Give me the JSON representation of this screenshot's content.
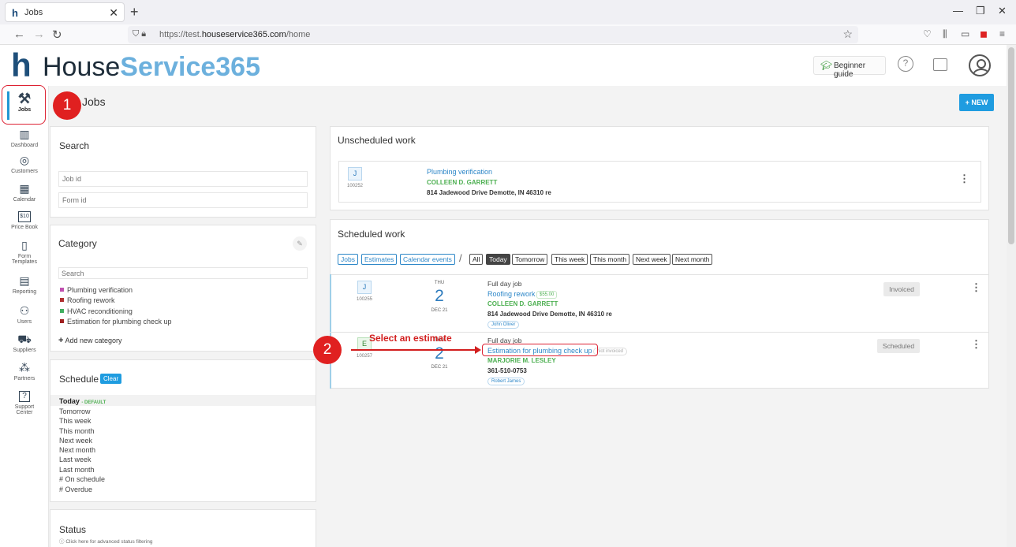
{
  "browser": {
    "tab_title": "Jobs",
    "tab_close": "✕",
    "new_tab": "+",
    "url_prefix": "https://test.",
    "url_domain": "houseservice365.com",
    "url_path": "/home"
  },
  "header": {
    "logo_mark": "h",
    "logo_part1": "House",
    "logo_part2": "Service365",
    "beginner_guide": "Beginner guide",
    "help_glyph": "?"
  },
  "sidebar": {
    "items": [
      {
        "label": "Jobs",
        "icon": "tools-icon",
        "glyph": "⚒"
      },
      {
        "label": "Dashboard",
        "icon": "bar-chart-icon",
        "glyph": "▥"
      },
      {
        "label": "Customers",
        "icon": "target-icon",
        "glyph": "◎"
      },
      {
        "label": "Calendar",
        "icon": "calendar-icon",
        "glyph": "▦"
      },
      {
        "label": "Price Book",
        "icon": "price-tag-icon",
        "glyph": "$10"
      },
      {
        "label": "Form",
        "label2": "Templates",
        "icon": "form-icon",
        "glyph": "▯"
      },
      {
        "label": "Reporting",
        "icon": "report-icon",
        "glyph": "▤"
      },
      {
        "label": "Users",
        "icon": "users-icon",
        "glyph": "⚇"
      },
      {
        "label": "Suppliers",
        "icon": "truck-icon",
        "glyph": "⛟"
      },
      {
        "label": "Partners",
        "icon": "partners-icon",
        "glyph": "⁂"
      },
      {
        "label": "Support",
        "label2": "Center",
        "icon": "support-icon",
        "glyph": "?"
      }
    ]
  },
  "annotations": {
    "step1": "1",
    "step2": "2",
    "step2_text": "Select an estimate"
  },
  "page": {
    "title": "Jobs",
    "new_button": "+ NEW"
  },
  "search": {
    "title": "Search",
    "job_id_placeholder": "Job id",
    "form_id_placeholder": "Form id"
  },
  "category": {
    "title": "Category",
    "search_placeholder": "Search",
    "items": [
      {
        "label": "Plumbing verification",
        "color": "#c050b0"
      },
      {
        "label": "Roofing rework",
        "color": "#b03030"
      },
      {
        "label": "HVAC reconditioning",
        "color": "#40b060"
      },
      {
        "label": "Estimation for plumbing check up",
        "color": "#a02020"
      }
    ],
    "add_new": "Add new category"
  },
  "schedule": {
    "title": "Schedule",
    "clear": "Clear",
    "today": "Today",
    "default_tag": "- DEFAULT",
    "items": [
      "Tomorrow",
      "This week",
      "This month",
      "Next week",
      "Next month",
      "Last week",
      "Last month",
      "# On schedule",
      "# Overdue"
    ]
  },
  "status_panel": {
    "title": "Status",
    "hint": "Click here for advanced status filtering"
  },
  "unscheduled": {
    "title": "Unscheduled work",
    "job": {
      "type": "J",
      "id": "100252",
      "name": "Plumbing verification",
      "customer": "COLLEEN D. GARRETT",
      "address": "814 Jadewood Drive Demotte, IN 46310 re"
    }
  },
  "scheduled": {
    "title": "Scheduled work",
    "filters": [
      "Jobs",
      "Estimates",
      "Calendar events"
    ],
    "separator": "/",
    "ranges": [
      "All",
      "Today",
      "Tomorrow",
      "This week",
      "This month",
      "Next week",
      "Next month"
    ],
    "jobs": [
      {
        "type": "J",
        "id": "100255",
        "day": "THU",
        "date": "2",
        "month": "DEC 21",
        "duration": "Full day job",
        "name": "Roofing rework",
        "price": "$55.00",
        "customer": "COLLEEN D. GARRETT",
        "detail": "814 Jadewood Drive Demotte, IN 46310 re",
        "assignee": "John Oliver",
        "status": "Invoiced"
      },
      {
        "type": "E",
        "id": "100257",
        "day": "THU",
        "date": "2",
        "month": "DEC 21",
        "duration": "Full day job",
        "name": "Estimation for plumbing check up",
        "extra": "Not invoiced",
        "customer": "MARJORIE M. LESLEY",
        "detail": "361-510-0753",
        "assignee": "Robert James",
        "status": "Scheduled"
      }
    ]
  }
}
